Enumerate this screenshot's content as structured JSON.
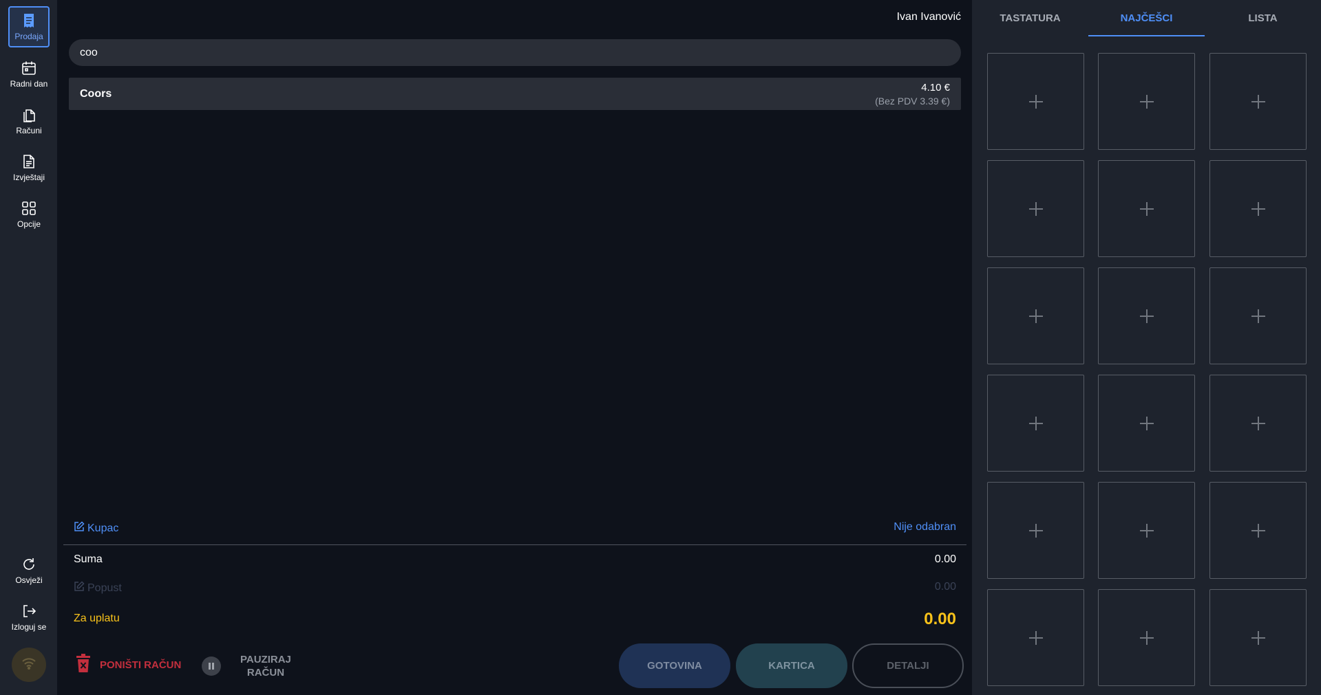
{
  "sidebar": {
    "items": [
      {
        "label": "Prodaja",
        "icon": "receipt-icon",
        "active": true
      },
      {
        "label": "Radni dan",
        "icon": "calendar-icon",
        "active": false
      },
      {
        "label": "Računi",
        "icon": "documents-icon",
        "active": false
      },
      {
        "label": "Izvještaji",
        "icon": "report-icon",
        "active": false
      },
      {
        "label": "Opcije",
        "icon": "grid-icon",
        "active": false
      }
    ],
    "bottom_items": [
      {
        "label": "Osvježi",
        "icon": "refresh-icon"
      },
      {
        "label": "Izloguj se",
        "icon": "logout-icon"
      }
    ],
    "status_icon": "wifi-icon"
  },
  "header": {
    "user_name": "Ivan Ivanović"
  },
  "search": {
    "value": "coo"
  },
  "results": [
    {
      "name": "Coors",
      "price": "4.10 €",
      "net_price": "(Bez PDV 3.39 €)"
    }
  ],
  "summary": {
    "customer_label": "Kupac",
    "customer_value": "Nije odabran",
    "sum_label": "Suma",
    "sum_value": "0.00",
    "discount_label": "Popust",
    "discount_value": "0.00",
    "total_label": "Za uplatu",
    "total_value": "0.00"
  },
  "actions": {
    "cancel_label": "PONIŠTI RAČUN",
    "pause_label_line1": "PAUZIRAJ",
    "pause_label_line2": "RAČUN",
    "cash_label": "GOTOVINA",
    "card_label": "KARTICA",
    "details_label": "DETALJI"
  },
  "right_panel": {
    "tabs": [
      {
        "label": "TASTATURA",
        "active": false
      },
      {
        "label": "NAJČEŠCI",
        "active": true
      },
      {
        "label": "LISTA",
        "active": false
      }
    ],
    "tile_count": 18
  },
  "colors": {
    "accent": "#4f8ff7",
    "total": "#f8c21a",
    "danger": "#c32f3d",
    "sidebar_bg": "#1e232d",
    "main_bg": "#0e121b"
  }
}
